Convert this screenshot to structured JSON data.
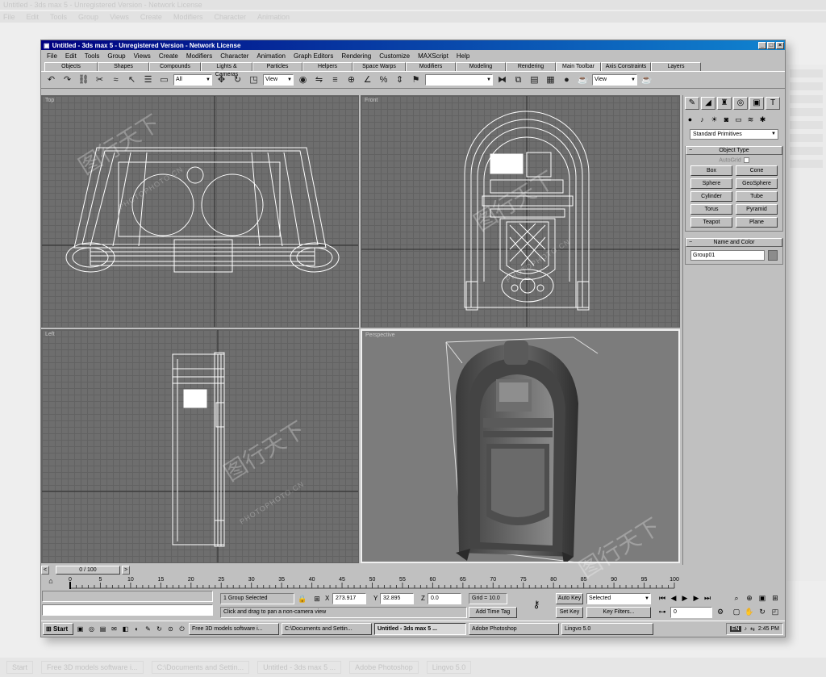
{
  "window": {
    "title": "Untitled - 3ds max 5 - Unregistered Version - Network License",
    "controls": [
      "_",
      "□",
      "×"
    ]
  },
  "menu": [
    "File",
    "Edit",
    "Tools",
    "Group",
    "Views",
    "Create",
    "Modifiers",
    "Character",
    "Animation",
    "Graph Editors",
    "Rendering",
    "Customize",
    "MAXScript",
    "Help"
  ],
  "tabs": [
    "Objects",
    "Shapes",
    "Compounds",
    "Lights & Cameras",
    "Particles",
    "Helpers",
    "Space Warps",
    "Modifiers",
    "Modeling",
    "Rendering",
    "Main Toolbar",
    "Axis Constraints",
    "Layers"
  ],
  "active_tab": "Main Toolbar",
  "toolbar": {
    "filter_value": "All",
    "ref_coord_value": "View",
    "named_sel_value": "",
    "render_view_value": "View"
  },
  "viewports": {
    "top": "Top",
    "front": "Front",
    "left": "Left",
    "perspective": "Perspective"
  },
  "command_panel": {
    "dropdown": "Standard Primitives",
    "object_type_title": "Object Type",
    "autogrid_label": "AutoGrid",
    "primitives": [
      "Box",
      "Cone",
      "Sphere",
      "GeoSphere",
      "Cylinder",
      "Tube",
      "Torus",
      "Pyramid",
      "Teapot",
      "Plane"
    ],
    "name_color_title": "Name and Color",
    "object_name": "Group01"
  },
  "time_slider": {
    "position": "0 / 100",
    "current_frame": 0,
    "total_frames": 100,
    "ticks": [
      "0",
      "5",
      "10",
      "15",
      "20",
      "25",
      "30",
      "35",
      "40",
      "45",
      "50",
      "55",
      "60",
      "65",
      "70",
      "75",
      "80",
      "85",
      "90",
      "95",
      "100"
    ]
  },
  "status": {
    "selection": "1 Group Selected",
    "prompt": "Click and drag to pan a non-camera view",
    "x_label": "X",
    "x_value": "273.917",
    "y_label": "Y",
    "y_value": "32.895",
    "z_label": "Z",
    "z_value": "0.0",
    "grid": "Grid = 10.0",
    "add_time_tag": "Add Time Tag",
    "auto_key": "Auto Key",
    "set_key": "Set Key",
    "key_mode_value": "Selected",
    "key_filters": "Key Filters...",
    "frame_value": "0"
  },
  "taskbar": {
    "start": "Start",
    "tasks": [
      "Free 3D models software i...",
      "C:\\Documents and Settin...",
      "Untitled - 3ds max 5 ...",
      "Adobe Photoshop",
      "Lingvo 5.0"
    ],
    "active_task": 2,
    "language": "EN",
    "clock": "2:45 PM"
  },
  "watermark": {
    "text": "图行天下",
    "sub": "PHOTOPHOTO.CN"
  },
  "colors": {
    "title_bar_start": "#000080",
    "title_bar_end": "#1084d0",
    "viewport_grid": "#6e6e6e",
    "wireframe": "#ffffff",
    "ui_face": "#c0c0c0"
  }
}
